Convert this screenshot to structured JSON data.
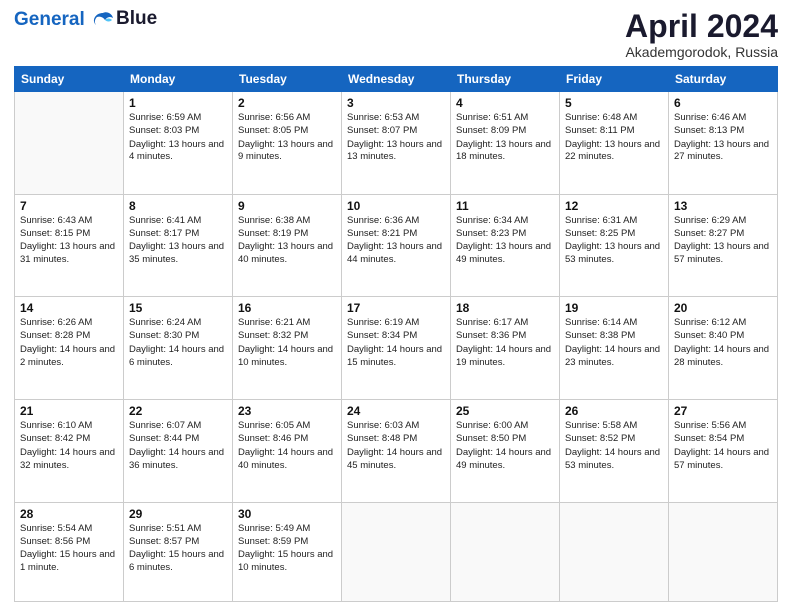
{
  "header": {
    "logo_line1": "General",
    "logo_line2": "Blue",
    "month_title": "April 2024",
    "location": "Akademgorodok, Russia"
  },
  "weekdays": [
    "Sunday",
    "Monday",
    "Tuesday",
    "Wednesday",
    "Thursday",
    "Friday",
    "Saturday"
  ],
  "weeks": [
    [
      {
        "day": "",
        "sunrise": "",
        "sunset": "",
        "daylight": ""
      },
      {
        "day": "1",
        "sunrise": "6:59 AM",
        "sunset": "8:03 PM",
        "daylight": "13 hours and 4 minutes."
      },
      {
        "day": "2",
        "sunrise": "6:56 AM",
        "sunset": "8:05 PM",
        "daylight": "13 hours and 9 minutes."
      },
      {
        "day": "3",
        "sunrise": "6:53 AM",
        "sunset": "8:07 PM",
        "daylight": "13 hours and 13 minutes."
      },
      {
        "day": "4",
        "sunrise": "6:51 AM",
        "sunset": "8:09 PM",
        "daylight": "13 hours and 18 minutes."
      },
      {
        "day": "5",
        "sunrise": "6:48 AM",
        "sunset": "8:11 PM",
        "daylight": "13 hours and 22 minutes."
      },
      {
        "day": "6",
        "sunrise": "6:46 AM",
        "sunset": "8:13 PM",
        "daylight": "13 hours and 27 minutes."
      }
    ],
    [
      {
        "day": "7",
        "sunrise": "6:43 AM",
        "sunset": "8:15 PM",
        "daylight": "13 hours and 31 minutes."
      },
      {
        "day": "8",
        "sunrise": "6:41 AM",
        "sunset": "8:17 PM",
        "daylight": "13 hours and 35 minutes."
      },
      {
        "day": "9",
        "sunrise": "6:38 AM",
        "sunset": "8:19 PM",
        "daylight": "13 hours and 40 minutes."
      },
      {
        "day": "10",
        "sunrise": "6:36 AM",
        "sunset": "8:21 PM",
        "daylight": "13 hours and 44 minutes."
      },
      {
        "day": "11",
        "sunrise": "6:34 AM",
        "sunset": "8:23 PM",
        "daylight": "13 hours and 49 minutes."
      },
      {
        "day": "12",
        "sunrise": "6:31 AM",
        "sunset": "8:25 PM",
        "daylight": "13 hours and 53 minutes."
      },
      {
        "day": "13",
        "sunrise": "6:29 AM",
        "sunset": "8:27 PM",
        "daylight": "13 hours and 57 minutes."
      }
    ],
    [
      {
        "day": "14",
        "sunrise": "6:26 AM",
        "sunset": "8:28 PM",
        "daylight": "14 hours and 2 minutes."
      },
      {
        "day": "15",
        "sunrise": "6:24 AM",
        "sunset": "8:30 PM",
        "daylight": "14 hours and 6 minutes."
      },
      {
        "day": "16",
        "sunrise": "6:21 AM",
        "sunset": "8:32 PM",
        "daylight": "14 hours and 10 minutes."
      },
      {
        "day": "17",
        "sunrise": "6:19 AM",
        "sunset": "8:34 PM",
        "daylight": "14 hours and 15 minutes."
      },
      {
        "day": "18",
        "sunrise": "6:17 AM",
        "sunset": "8:36 PM",
        "daylight": "14 hours and 19 minutes."
      },
      {
        "day": "19",
        "sunrise": "6:14 AM",
        "sunset": "8:38 PM",
        "daylight": "14 hours and 23 minutes."
      },
      {
        "day": "20",
        "sunrise": "6:12 AM",
        "sunset": "8:40 PM",
        "daylight": "14 hours and 28 minutes."
      }
    ],
    [
      {
        "day": "21",
        "sunrise": "6:10 AM",
        "sunset": "8:42 PM",
        "daylight": "14 hours and 32 minutes."
      },
      {
        "day": "22",
        "sunrise": "6:07 AM",
        "sunset": "8:44 PM",
        "daylight": "14 hours and 36 minutes."
      },
      {
        "day": "23",
        "sunrise": "6:05 AM",
        "sunset": "8:46 PM",
        "daylight": "14 hours and 40 minutes."
      },
      {
        "day": "24",
        "sunrise": "6:03 AM",
        "sunset": "8:48 PM",
        "daylight": "14 hours and 45 minutes."
      },
      {
        "day": "25",
        "sunrise": "6:00 AM",
        "sunset": "8:50 PM",
        "daylight": "14 hours and 49 minutes."
      },
      {
        "day": "26",
        "sunrise": "5:58 AM",
        "sunset": "8:52 PM",
        "daylight": "14 hours and 53 minutes."
      },
      {
        "day": "27",
        "sunrise": "5:56 AM",
        "sunset": "8:54 PM",
        "daylight": "14 hours and 57 minutes."
      }
    ],
    [
      {
        "day": "28",
        "sunrise": "5:54 AM",
        "sunset": "8:56 PM",
        "daylight": "15 hours and 1 minute."
      },
      {
        "day": "29",
        "sunrise": "5:51 AM",
        "sunset": "8:57 PM",
        "daylight": "15 hours and 6 minutes."
      },
      {
        "day": "30",
        "sunrise": "5:49 AM",
        "sunset": "8:59 PM",
        "daylight": "15 hours and 10 minutes."
      },
      {
        "day": "",
        "sunrise": "",
        "sunset": "",
        "daylight": ""
      },
      {
        "day": "",
        "sunrise": "",
        "sunset": "",
        "daylight": ""
      },
      {
        "day": "",
        "sunrise": "",
        "sunset": "",
        "daylight": ""
      },
      {
        "day": "",
        "sunrise": "",
        "sunset": "",
        "daylight": ""
      }
    ]
  ],
  "labels": {
    "sunrise_prefix": "Sunrise: ",
    "sunset_prefix": "Sunset: ",
    "daylight_prefix": "Daylight: "
  }
}
